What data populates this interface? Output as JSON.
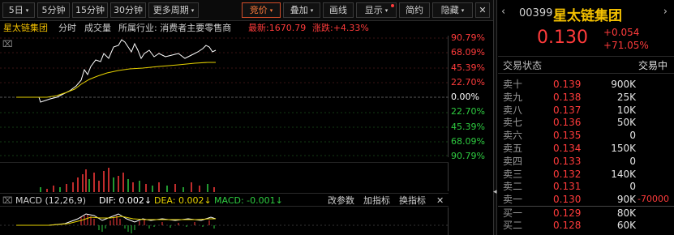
{
  "toolbar": {
    "buttons": [
      {
        "label": "5日",
        "caret": "▾"
      },
      {
        "label": "5分钟"
      },
      {
        "label": "15分钟"
      },
      {
        "label": "30分钟"
      },
      {
        "label": "更多周期",
        "caret": "▾"
      },
      {
        "label": "竞价",
        "caret": "▾"
      },
      {
        "label": "叠加",
        "caret": "▾"
      },
      {
        "label": "画线"
      },
      {
        "label": "显示",
        "caret": "▾"
      },
      {
        "label": "简约"
      },
      {
        "label": "隐藏",
        "caret": "▾"
      }
    ],
    "close_label": "✕"
  },
  "info": {
    "name": "星太链集团",
    "mode": "分时",
    "volume_label": "成交量",
    "industry": "所属行业: 消费者主要零售商",
    "latest": "最新:1670.79",
    "change": "涨跌:+4.33%"
  },
  "pct_labels_up": [
    "90.79%",
    "68.09%",
    "45.39%",
    "22.70%"
  ],
  "pct_zero": "0.00%",
  "pct_labels_down": [
    "22.70%",
    "45.39%",
    "68.09%",
    "90.79%"
  ],
  "macd": {
    "label": "MACD (12,26,9)",
    "dif": "DIF: 0.002↓",
    "dea": "DEA: 0.002↓",
    "macd": "MACD: -0.001↓",
    "params": "改参数",
    "add_indicator": "加指标",
    "switch_indicator": "换指标",
    "close": "✕"
  },
  "quote": {
    "code": "00399",
    "name": "星太链集团",
    "price": "0.130",
    "change": "+0.054",
    "change_pct": "+71.05%",
    "status_label": "交易状态",
    "status_value": "交易中"
  },
  "order_book": [
    {
      "label": "卖十",
      "price": "0.139",
      "qty": "900K",
      "extra": ""
    },
    {
      "label": "卖九",
      "price": "0.138",
      "qty": "25K",
      "extra": ""
    },
    {
      "label": "卖八",
      "price": "0.137",
      "qty": "10K",
      "extra": ""
    },
    {
      "label": "卖七",
      "price": "0.136",
      "qty": "50K",
      "extra": ""
    },
    {
      "label": "卖六",
      "price": "0.135",
      "qty": "0",
      "extra": ""
    },
    {
      "label": "卖五",
      "price": "0.134",
      "qty": "150K",
      "extra": ""
    },
    {
      "label": "卖四",
      "price": "0.133",
      "qty": "0",
      "extra": ""
    },
    {
      "label": "卖三",
      "price": "0.132",
      "qty": "140K",
      "extra": ""
    },
    {
      "label": "卖二",
      "price": "0.131",
      "qty": "0",
      "extra": ""
    },
    {
      "label": "卖一",
      "price": "0.130",
      "qty": "90K",
      "extra": "-70000"
    },
    {
      "label": "买一",
      "price": "0.129",
      "qty": "80K",
      "extra": ""
    },
    {
      "label": "买二",
      "price": "0.128",
      "qty": "60K",
      "extra": ""
    }
  ],
  "colors": {
    "up": "#ff3b3b",
    "down": "#2ecc40",
    "price_line": "#ffffff",
    "avg_line": "#e6d200",
    "accent": "#ff7a3c",
    "name": "#f3c000"
  }
}
